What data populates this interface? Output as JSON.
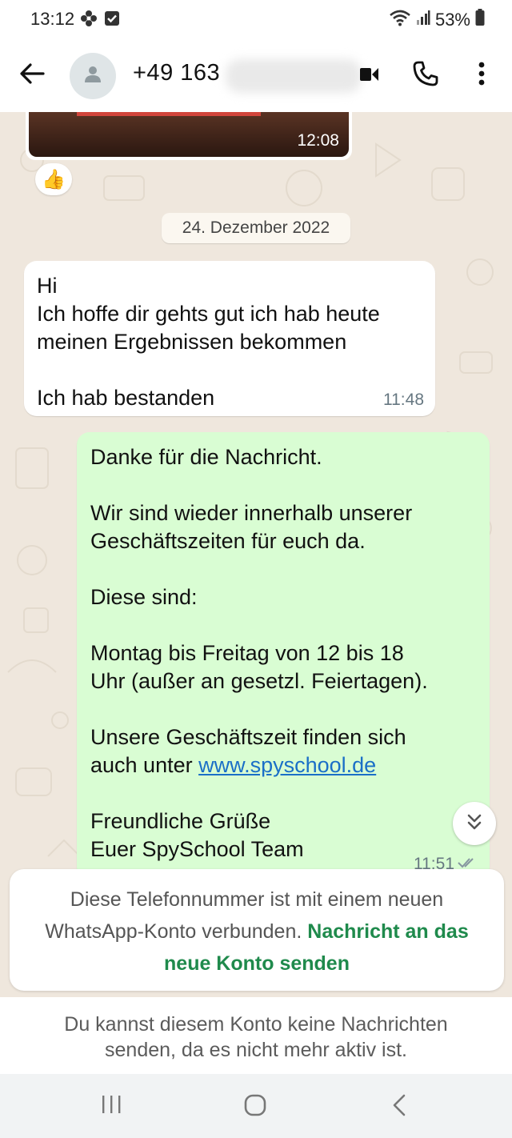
{
  "status_bar": {
    "time": "13:12",
    "battery": "53%",
    "icons": [
      "flower-icon",
      "check-square-icon",
      "wifi-icon",
      "signal-icon",
      "battery-icon"
    ]
  },
  "header": {
    "contact_number": "+49 163",
    "icons": [
      "back-arrow-icon",
      "avatar-icon",
      "video-call-icon",
      "phone-icon",
      "more-vert-icon"
    ]
  },
  "chat": {
    "image_message": {
      "time": "12:08",
      "reaction": "👍"
    },
    "date_separator": "24. Dezember 2022",
    "incoming": {
      "lines": [
        "Hi",
        "Ich hoffe dir gehts gut ich hab heute",
        "meinen Ergebnissen bekommen",
        "",
        "Ich hab bestanden"
      ],
      "time": "11:48"
    },
    "outgoing": {
      "lines": [
        "Danke für die Nachricht.",
        "",
        "Wir sind wieder innerhalb unserer",
        "Geschäftszeiten für euch da.",
        "",
        "Diese sind:",
        "",
        "Montag bis Freitag von 12 bis 18",
        "Uhr (außer an gesetzl. Feiertagen).",
        "",
        "Unsere Geschäftszeit finden sich"
      ],
      "link_prefix": "auch unter ",
      "link": "www.spyschool.de",
      "closing_lines": [
        "",
        "Freundliche Grüße",
        "Euer SpySchool Team"
      ],
      "time": "11:51"
    }
  },
  "notice": {
    "text": "Diese Telefonnummer ist mit einem neuen WhatsApp-Konto verbunden.",
    "action": "Nachricht an das neue Konto senden"
  },
  "footer": {
    "line1": "Du kannst diesem Konto keine Nachrichten",
    "line2": "senden, da es nicht mehr aktiv ist."
  },
  "colors": {
    "chat_background": "#efe7dd",
    "outgoing_bubble": "#d9fdd3",
    "incoming_bubble": "#ffffff",
    "accent_green": "#1f8a4c",
    "link_blue": "#1a6fc7"
  }
}
